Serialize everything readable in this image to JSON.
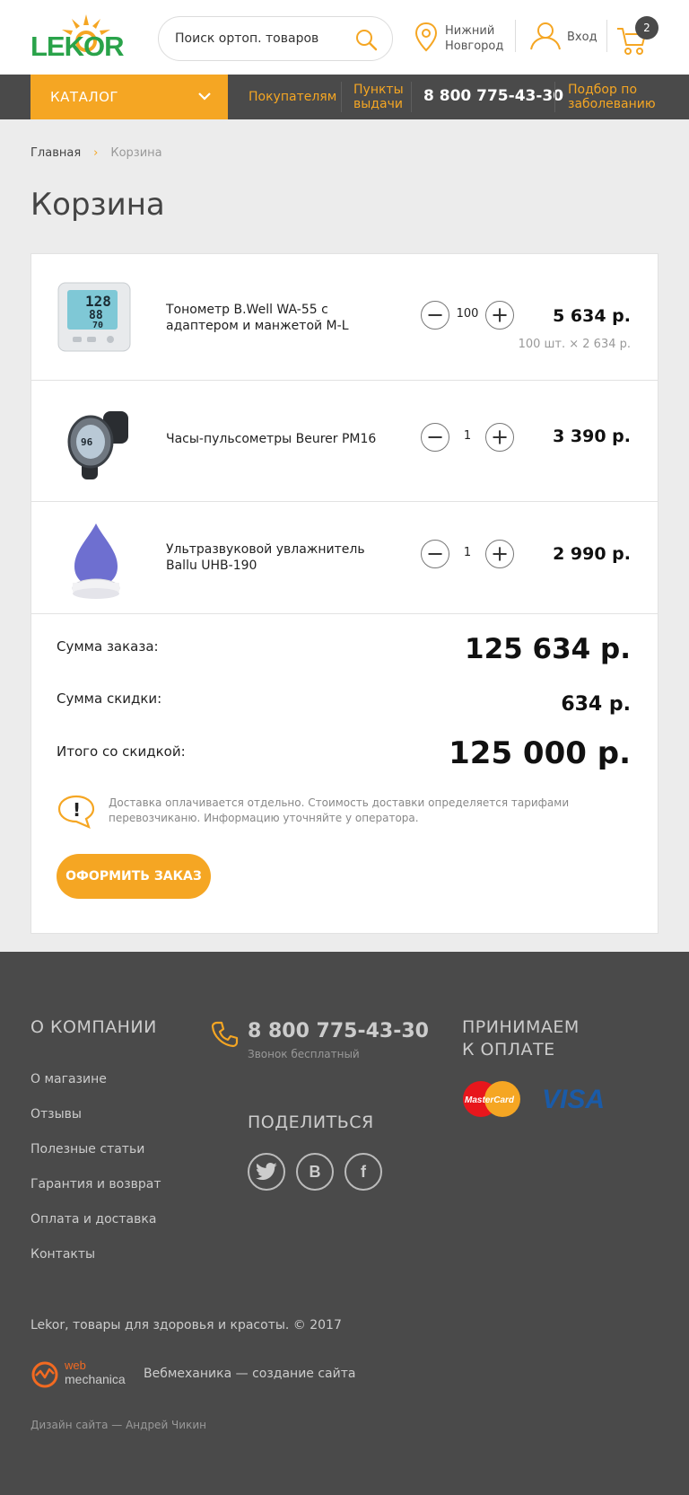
{
  "header": {
    "logo_text": "LEKOR",
    "search_placeholder": "Поиск ортоп. товаров",
    "city_line1": "Нижний",
    "city_line2": "Новгород",
    "login_label": "Вход",
    "cart_count": "2"
  },
  "nav": {
    "catalog_label": "КАТАЛОГ",
    "buyers": "Покупателям",
    "pickup_line1": "Пункты",
    "pickup_line2": "выдачи",
    "phone": "8 800 775-43-30",
    "by_disease_line1": "Подбор по",
    "by_disease_line2": "заболеванию"
  },
  "breadcrumb": {
    "home": "Главная",
    "separator": "›",
    "current": "Корзина"
  },
  "page_title": "Корзина",
  "cart": {
    "items": [
      {
        "name": "Тонометр B.Well WA-55 с адаптером и манжетой M-L",
        "qty": "100",
        "price": "5 634 р.",
        "subprice": "100 шт. × 2 634 р."
      },
      {
        "name": "Часы-пульсометры Beurer PM16",
        "qty": "1",
        "price": "3 390 р."
      },
      {
        "name": "Ультразвуковой увлажнитель Ballu UHB-190",
        "qty": "1",
        "price": "2 990 р."
      }
    ],
    "order_sum_label": "Сумма заказа:",
    "order_sum_value": "125 634 р.",
    "discount_label": "Сумма скидки:",
    "discount_value": "634 р.",
    "total_label": "Итого со скидкой:",
    "total_value": "125 000 р.",
    "notice": "Доставка оплачивается отдельно. Стоимость доставки определяется тарифами перевозчиканю. Информацию уточняйте у оператора.",
    "order_button": "ОФОРМИТЬ ЗАКАЗ"
  },
  "footer": {
    "about_heading": "О КОМПАНИИ",
    "links": [
      "О  магазине",
      "Отзывы",
      "Полезные статьи",
      "Гарантия и возврат",
      "Оплата и доставка",
      "Контакты"
    ],
    "phone": "8 800 775-43-30",
    "phone_note": "Звонок бесплатный",
    "share_heading": "ПОДЕЛИТЬСЯ",
    "payment_heading_line1": "ПРИНИМАЕМ",
    "payment_heading_line2": "К ОПЛАТЕ",
    "mastercard_label": "MasterCard",
    "visa_label": "VISA",
    "copyright": "Lekor, товары для здоровья и красоты. © 2017",
    "webmechanica_line1": "web",
    "webmechanica_line2": "mechanica",
    "developer": "Вебмеханика — создание сайта",
    "design_credit": "Дизайн сайта — Андрей Чикин"
  },
  "colors": {
    "accent": "#f5a623",
    "brand_green": "#2aa34a",
    "dark": "#4a4a4a"
  }
}
